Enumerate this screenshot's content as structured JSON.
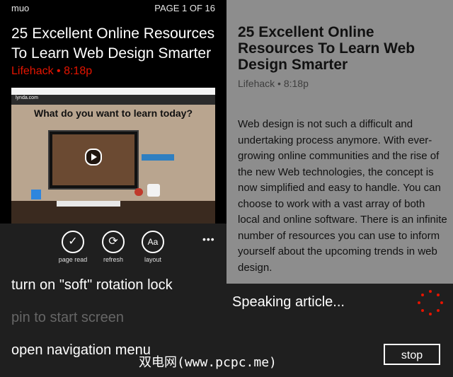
{
  "left": {
    "source": "muo",
    "page_indicator": "PAGE 1 OF 16",
    "title": "25 Excellent Online Resources To Learn Web Design Smarter",
    "meta": "Lifehack • 8:18p",
    "screenshot": {
      "logo": "lynda.com",
      "headline": "What do you want to learn today?"
    },
    "appbar": {
      "buttons": [
        {
          "icon": "check-icon",
          "glyph": "✓",
          "label": "page read"
        },
        {
          "icon": "refresh-icon",
          "glyph": "⟳",
          "label": "refresh"
        },
        {
          "icon": "font-size-icon",
          "glyph": "Aa",
          "label": "layout"
        }
      ],
      "more": "•••",
      "menu": [
        {
          "label": "turn on \"soft\" rotation lock",
          "enabled": true
        },
        {
          "label": "pin to start screen",
          "enabled": false
        },
        {
          "label": "open navigation menu",
          "enabled": true
        }
      ]
    }
  },
  "right": {
    "title": "25 Excellent Online Resources To Learn Web Design Smarter",
    "meta": "Lifehack • 8:18p",
    "body": "Web design is not such a difficult and undertaking process anymore. With ever-growing online communities and the rise of the new Web technologies, the concept is now simplified and easy to handle. You can choose to work with a vast array of both local and online software. There is an infinite number of resources you can use to inform yourself about the upcoming trends in web design.",
    "speaking": "Speaking article...",
    "stop": "stop"
  },
  "watermark": "双电网(www.pcpc.me)",
  "colors": {
    "accent": "#e51400",
    "article_bg": "#8d8d8d",
    "appbar_bg": "#1f1f1f"
  }
}
